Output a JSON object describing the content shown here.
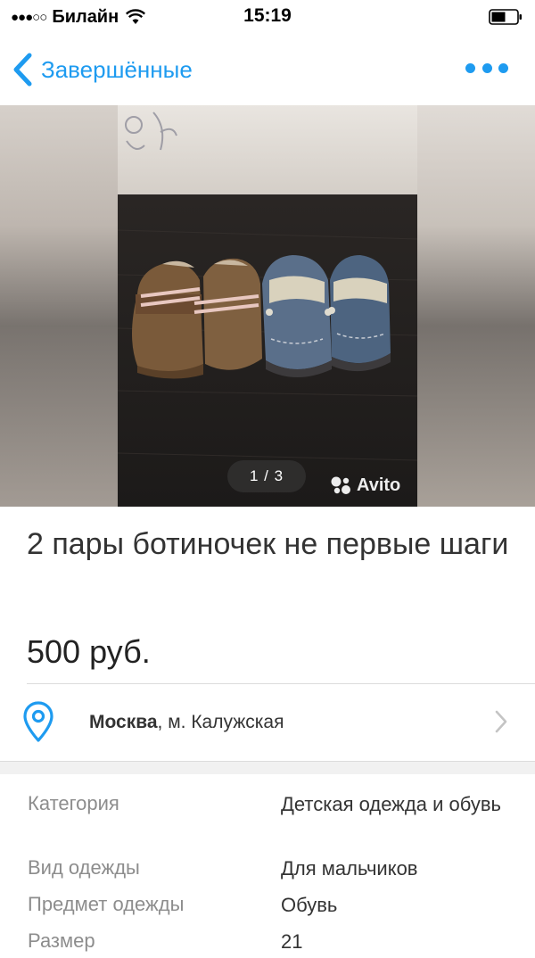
{
  "status_bar": {
    "signal": "●●●○○",
    "carrier": "Билайн",
    "time": "15:19"
  },
  "nav": {
    "back_label": "Завершённые",
    "back_icon": "chevron-left-icon",
    "more_icon": "more-dots-icon",
    "accent_color": "#1e9bf0"
  },
  "gallery": {
    "counter": "1 / 3",
    "watermark": "Avito"
  },
  "listing": {
    "title": "2 пары ботиночек не первые шаги",
    "price": "500 руб."
  },
  "location": {
    "city": "Москва",
    "metro": ", м. Калужская",
    "icon": "location-pin-icon"
  },
  "params": [
    {
      "label": "Категория",
      "value": "Детская одежда и обувь"
    },
    {
      "label": "Вид одежды",
      "value": "Для мальчиков"
    },
    {
      "label": "Предмет одежды",
      "value": "Обувь"
    },
    {
      "label": "Размер",
      "value": "21"
    }
  ]
}
